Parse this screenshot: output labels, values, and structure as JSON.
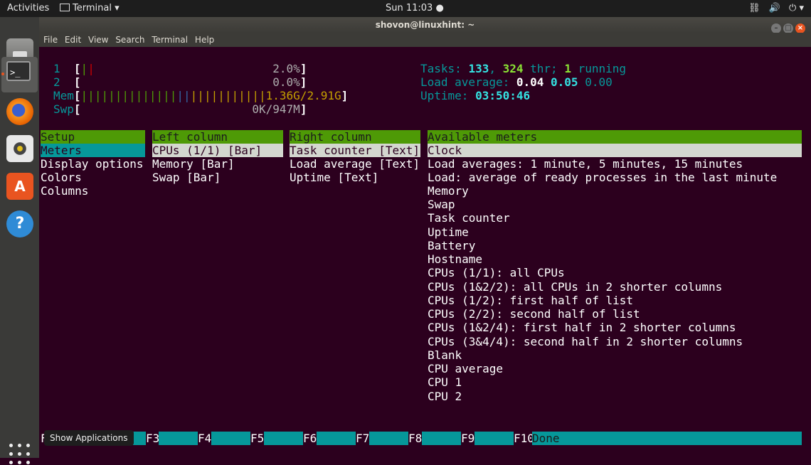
{
  "topbar": {
    "activities": "Activities",
    "app_menu": "Terminal ▾",
    "clock": "Sun 11:03 ●",
    "status_icons": [
      "network-icon",
      "volume-icon",
      "power-icon"
    ]
  },
  "window": {
    "title": "shovon@linuxhint: ~",
    "menu": [
      "File",
      "Edit",
      "View",
      "Search",
      "Terminal",
      "Help"
    ]
  },
  "meters": {
    "cpu1_label": "1",
    "cpu1_value": "2.0%",
    "cpu2_label": "2",
    "cpu2_value": "0.0%",
    "mem_label": "Mem",
    "mem_value": "1.36G/2.91G",
    "swp_label": "Swp",
    "swp_value": "0K/947M",
    "tasks_label": "Tasks: ",
    "tasks_count": "133",
    "threads": "324",
    "thr_label": " thr; ",
    "running": "1",
    "running_label": " running",
    "load_label": "Load average: ",
    "load1": "0.04",
    "load5": "0.05",
    "load15": "0.00",
    "uptime_label": "Uptime: ",
    "uptime": "03:50:46"
  },
  "setup": {
    "header": "Setup",
    "items": [
      "Meters",
      "Display options",
      "Colors",
      "Columns"
    ]
  },
  "left_column": {
    "header": "Left column",
    "items": [
      "CPUs (1/1) [Bar]",
      "Memory [Bar]",
      "Swap [Bar]"
    ]
  },
  "right_column": {
    "header": "Right column",
    "items": [
      "Task counter [Text]",
      "Load average [Text]",
      "Uptime [Text]"
    ]
  },
  "available_meters": {
    "header": "Available meters",
    "items": [
      "Clock",
      "Load averages: 1 minute, 5 minutes, 15 minutes",
      "Load: average of ready processes in the last minute",
      "Memory",
      "Swap",
      "Task counter",
      "Uptime",
      "Battery",
      "Hostname",
      "CPUs (1/1): all CPUs",
      "CPUs (1&2/2): all CPUs in 2 shorter columns",
      "CPUs (1/2): first half of list",
      "CPUs (2/2): second half of list",
      "CPUs (1&2/4): first half in 2 shorter columns",
      "CPUs (3&4/4): second half in 2 shorter columns",
      "Blank",
      "CPU average",
      "CPU 1",
      "CPU 2"
    ]
  },
  "fkeys": {
    "f1": "F",
    "f3": "F3",
    "f4": "F4",
    "f5": "F5",
    "f6": "F6",
    "f7": "F7",
    "f8": "F8",
    "f9": "F9",
    "f10": "F10",
    "f10_label": "Done"
  },
  "tooltip": "Show Applications"
}
